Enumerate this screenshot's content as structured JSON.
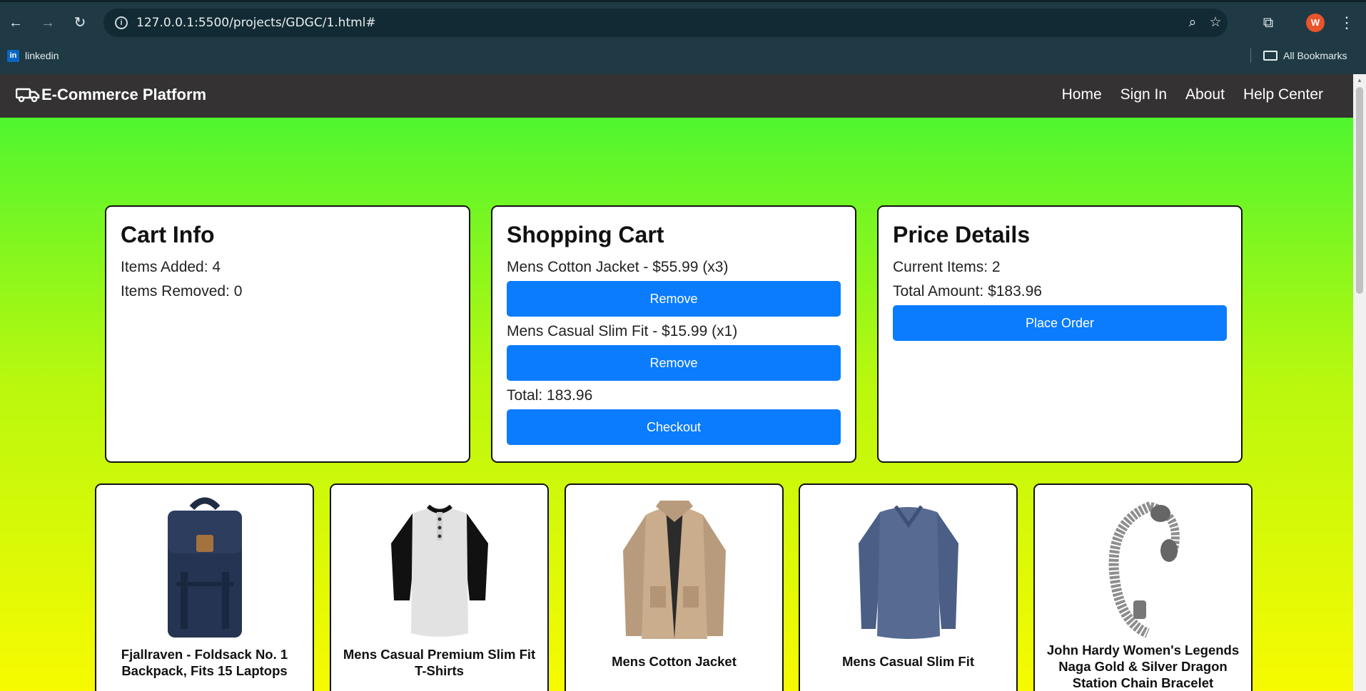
{
  "browser": {
    "url": "127.0.0.1:5500/projects/GDGC/1.html#",
    "avatar_letter": "W",
    "bookmarks": [
      {
        "label": "linkedin",
        "icon": "linkedin-icon"
      }
    ],
    "all_bookmarks_label": "All Bookmarks"
  },
  "navbar": {
    "brand": "E-Commerce Platform",
    "brand_icon": "truck-icon",
    "links": [
      "Home",
      "Sign In",
      "About",
      "Help Center"
    ]
  },
  "cart_info": {
    "title": "Cart Info",
    "items_added": "Items Added: 4",
    "items_removed": "Items Removed: 0"
  },
  "shopping_cart": {
    "title": "Shopping Cart",
    "items": [
      {
        "text": "Mens Cotton Jacket - $55.99 (x3)",
        "button": "Remove"
      },
      {
        "text": "Mens Casual Slim Fit - $15.99 (x1)",
        "button": "Remove"
      }
    ],
    "total": "Total: 183.96",
    "checkout_label": "Checkout"
  },
  "price_details": {
    "title": "Price Details",
    "current_items": "Current Items: 2",
    "total_amount": "Total Amount: $183.96",
    "place_order_label": "Place Order"
  },
  "products": [
    {
      "title": "Fjallraven - Foldsack No. 1 Backpack, Fits 15 Laptops",
      "image": "backpack"
    },
    {
      "title": "Mens Casual Premium Slim Fit T-Shirts",
      "image": "raglan-tshirt"
    },
    {
      "title": "Mens Cotton Jacket",
      "image": "cotton-jacket"
    },
    {
      "title": "Mens Casual Slim Fit",
      "image": "longsleeve-shirt"
    },
    {
      "title": "John Hardy Women's Legends Naga Gold & Silver Dragon Station Chain Bracelet",
      "image": "dragon-bracelet"
    }
  ],
  "colors": {
    "navbar_bg": "#343232",
    "button_blue": "#0a7cfd",
    "gradient_top": "#3ef535",
    "gradient_bottom": "#f7fa00"
  }
}
